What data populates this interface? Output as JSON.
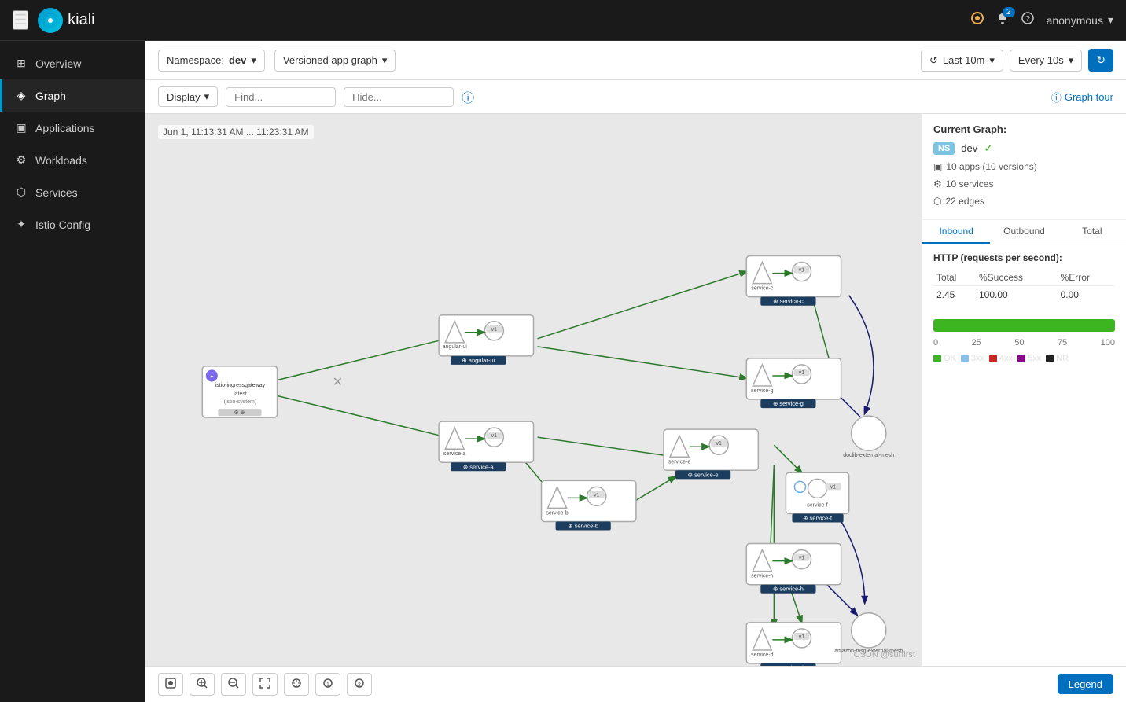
{
  "topnav": {
    "hamburger_label": "☰",
    "logo_text": "kiali",
    "notification_count": "2",
    "user_name": "anonymous"
  },
  "sidebar": {
    "items": [
      {
        "id": "overview",
        "label": "Overview",
        "icon": "⊞",
        "active": false
      },
      {
        "id": "graph",
        "label": "Graph",
        "icon": "◈",
        "active": true
      },
      {
        "id": "applications",
        "label": "Applications",
        "icon": "▣",
        "active": false
      },
      {
        "id": "workloads",
        "label": "Workloads",
        "icon": "⚙",
        "active": false
      },
      {
        "id": "services",
        "label": "Services",
        "icon": "⬡",
        "active": false
      },
      {
        "id": "istio-config",
        "label": "Istio Config",
        "icon": "✦",
        "active": false
      }
    ]
  },
  "toolbar": {
    "namespace_label": "Namespace:",
    "namespace_value": "dev",
    "graph_type": "Versioned app graph",
    "time_range": "Last 10m",
    "refresh_interval": "Every 10s"
  },
  "secondary_toolbar": {
    "display_label": "Display",
    "find_placeholder": "Find...",
    "hide_placeholder": "Hide...",
    "graph_tour_label": "Graph tour"
  },
  "graph": {
    "timestamp": "Jun 1, 11:13:31 AM ... 11:23:31 AM"
  },
  "bottom_toolbar": {
    "buttons": [
      "fit",
      "zoom-in",
      "zoom-out",
      "expand",
      "node-labels",
      "node-labels-1",
      "node-labels-2"
    ],
    "legend_label": "Legend"
  },
  "right_panel": {
    "title": "Current Graph:",
    "namespace": "dev",
    "ns_badge": "NS",
    "apps_info": "10 apps (10 versions)",
    "services_info": "10 services",
    "edges_info": "22 edges",
    "tabs": [
      "Inbound",
      "Outbound",
      "Total"
    ],
    "active_tab": "Inbound",
    "http_title": "HTTP (requests per second):",
    "table_headers": [
      "Total",
      "%Success",
      "%Error"
    ],
    "table_row": [
      "2.45",
      "100.00",
      "0.00"
    ],
    "progress_labels": [
      "0",
      "25",
      "50",
      "75",
      "100"
    ],
    "legend": [
      {
        "label": "OK",
        "color": "#3cb521"
      },
      {
        "label": "3xx",
        "color": "#88c0e8"
      },
      {
        "label": "4xx",
        "color": "#cc2222"
      },
      {
        "label": "5xx",
        "color": "#8b008b"
      },
      {
        "label": "NR",
        "color": "#222222"
      }
    ]
  },
  "watermark": "CSDN @surfirst"
}
